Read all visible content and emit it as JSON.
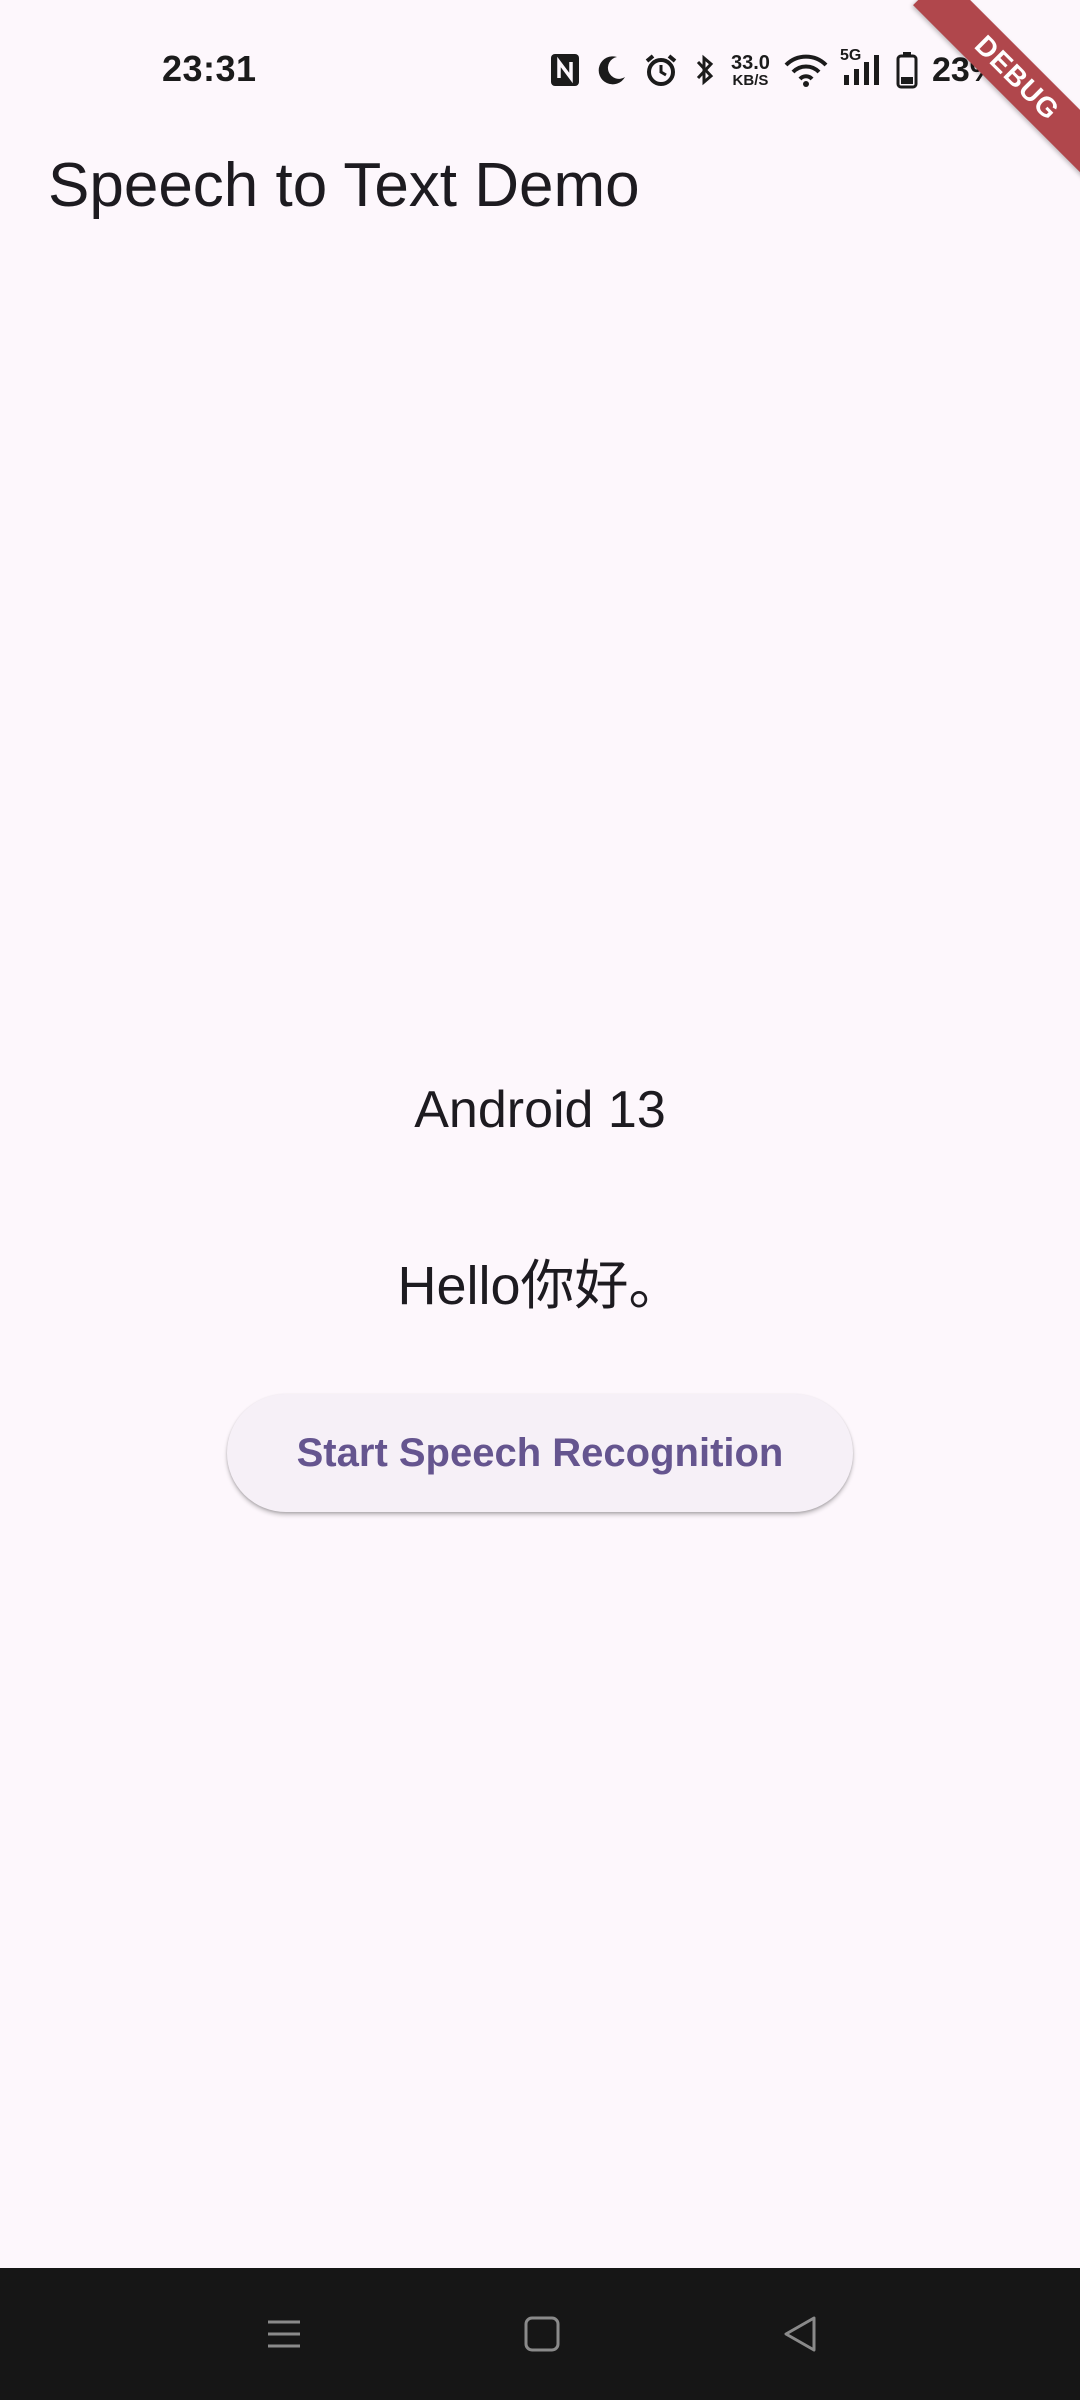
{
  "status_bar": {
    "time": "23:31",
    "net_speed_value": "33.0",
    "net_speed_unit": "KB/S",
    "signal_label": "5G",
    "battery_percent": "23%",
    "icons": [
      "nfc-icon",
      "moon-icon",
      "alarm-icon",
      "bluetooth-icon",
      "wifi-icon",
      "cell-signal-icon",
      "battery-icon"
    ]
  },
  "debug_banner": "DEBUG",
  "app_bar": {
    "title": "Speech to Text Demo"
  },
  "main": {
    "android_version": "Android 13",
    "recognized_text": "Hello你好。",
    "start_button_label": "Start Speech Recognition"
  },
  "nav_bar": {
    "buttons": [
      "menu-icon",
      "home-icon",
      "back-icon"
    ]
  },
  "colors": {
    "background": "#fdf7fc",
    "button_text": "#65558f",
    "button_bg": "#f6f0f7",
    "debug_ribbon": "#b0474c",
    "nav_bar": "#161616"
  }
}
